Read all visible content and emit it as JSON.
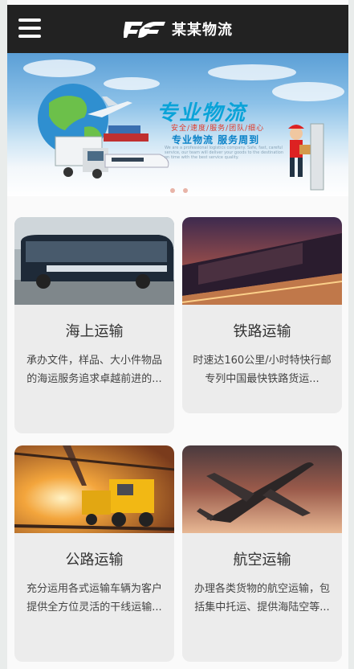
{
  "header": {
    "logo_text": "某某物流"
  },
  "banner": {
    "title": "专业物流",
    "tags": "安全/速度/服务/团队/细心",
    "subtitle": "专业物流 服务周到",
    "fine_print": "We are a professional logistics company. Safe, fast, careful service, our team will deliver your goods to the destination on time with the best service quality.",
    "slides": 2
  },
  "cards": [
    {
      "title": "海上运输",
      "desc": "承办文件，样品、大小件物品的海运服务追求卓越前进的...",
      "image": "bus-image"
    },
    {
      "title": "铁路运输",
      "desc": "时速达160公里/小时特快行邮专列中国最快铁路货运...",
      "image": "train-image"
    },
    {
      "title": "公路运输",
      "desc": "充分运用各式运输车辆为客户提供全方位灵活的干线运输...",
      "image": "trucks-image"
    },
    {
      "title": "航空运输",
      "desc": "办理各类货物的航空运输，包括集中托运、提供海陆空等...",
      "image": "airplane-image"
    }
  ],
  "colors": {
    "header_bg": "#222222",
    "card_bg": "#ececec",
    "banner_accent": "#0aa3d8"
  }
}
